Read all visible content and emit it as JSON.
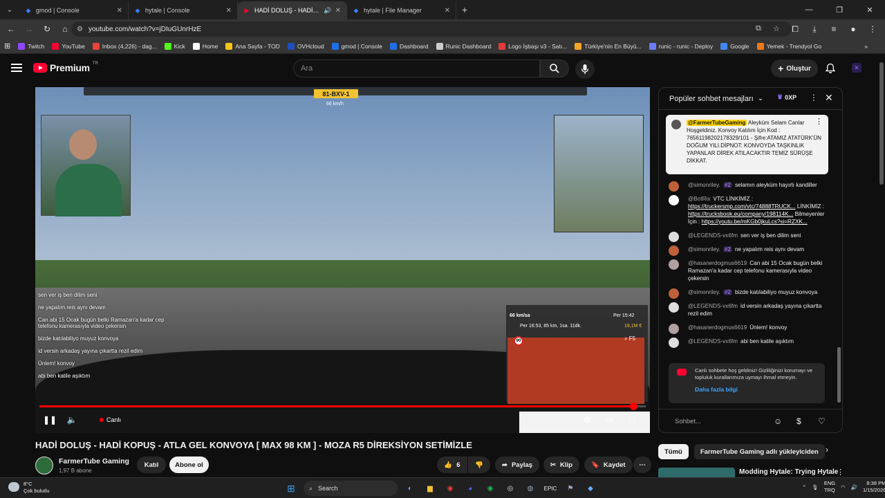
{
  "browser": {
    "tabs": [
      {
        "label": "gmod | Console",
        "active": false
      },
      {
        "label": "hytale | Console",
        "active": false
      },
      {
        "label": "HADİ DOLUŞ - HADİ KOPUŞ",
        "active": true
      },
      {
        "label": "hytale | File Manager",
        "active": false
      }
    ],
    "url": "youtube.com/watch?v=jDIuGUnrHzE",
    "bookmarks": [
      {
        "label": "Twitch",
        "color": "#9146ff"
      },
      {
        "label": "YouTube",
        "color": "#ff0033"
      },
      {
        "label": "Inbox (4,226) - dag...",
        "color": "#ea4335"
      },
      {
        "label": "Kick",
        "color": "#53fc18"
      },
      {
        "label": "Home",
        "color": "#ffffff"
      },
      {
        "label": "Ana Sayfa - TOD",
        "color": "#f5c518"
      },
      {
        "label": "OVHcloud",
        "color": "#1f4fbf"
      },
      {
        "label": "gmod | Console",
        "color": "#1f6feb"
      },
      {
        "label": "Dashboard",
        "color": "#1f6feb"
      },
      {
        "label": "Runic Dashboard",
        "color": "#cccccc"
      },
      {
        "label": "Logo İşbaşı v3 - Satı...",
        "color": "#e23b3b"
      },
      {
        "label": "Türkiye'nin En Büyü...",
        "color": "#f5a623"
      },
      {
        "label": "runic - runic - Deploy",
        "color": "#6b7cff"
      },
      {
        "label": "Google",
        "color": "#4285f4"
      },
      {
        "label": "Yemek - Trendyol Go",
        "color": "#f27a1a"
      }
    ]
  },
  "youtube": {
    "logo_text": "Premium",
    "logo_region": "TR",
    "search_placeholder": "Ara",
    "create_label": "Oluştur",
    "accent": "#ff0033"
  },
  "player": {
    "live_label": "Canlı",
    "progress_fraction": 0.98,
    "plate": "81-BXV-1",
    "hud_speed": "66 km/h",
    "hud_speed2": "66 km/sa",
    "hud_time1": "Per 15:42",
    "hud_eta": "Per 16:53, 85 km, 1sa. 11dk.",
    "hud_money": "19,1M €",
    "hud_limit": "90",
    "hud_f5": "F5",
    "overlay_chat": [
      "sen ver iş ben dilim seni",
      "ne yapalım reis aynı devam",
      "Can abi 15 Ocak bugün belki Ramazan'a kadar cep telefonu kamerasıyla video çekersin",
      "bizde katılabiliyo muyuz konvoya",
      "id versin arkadaş yayına çıkartta rezil edim",
      "Ünlem! konvoy",
      "abi ben katile aşıktım"
    ]
  },
  "video": {
    "title": "HADİ DOLUŞ - HADİ KOPUŞ - ATLA GEL KONVOYA [ MAX 98 KM ] - MOZA R5 DİREKSİYON SETİMİZLE",
    "channel": "FarmerTube Gaming",
    "subscribers": "1,97 B abone",
    "join_label": "Katıl",
    "subscribe_label": "Abone ol",
    "likes": "6",
    "share_label": "Paylaş",
    "clip_label": "Klip",
    "save_label": "Kaydet"
  },
  "chat": {
    "header": "Popüler sohbet mesajları",
    "xp": "0XP",
    "pinned": {
      "author": "@FarmerTubeGaming",
      "text": "Aleyküm Selam Canlar Hoşgeldiniz. Konvoy Katılım İçin Kod : 76561198202178329/101 - Şifre:ATAMIZ ATATÜRK'ÜN DOĞUM YILI.DİPNOT: KONVOYDA TAŞKINLIK YAPANLAR DİREK ATILACAKTIR TEMİZ SÜRÜŞE DİKKAT."
    },
    "messages": [
      {
        "author": "@simonriley.",
        "badge": "#2",
        "text": "selamın aleyküm hayırlı kandiller",
        "color": "#c0603a"
      },
      {
        "author": "@BotRix",
        "badge": "",
        "text": "VTC LİNKİMİZ : ",
        "link": "https://truckersmp.com/vtc/74888TRUCK...",
        "text2": " LİNKİMİZ : ",
        "link2": "https://trucksbook.eu/company/198114K...",
        "text3": " Bilmeyenler İçin : ",
        "link3": "https://youtu.be/mKGb0jkuLcs?si=RZXK...",
        "color": "#ffffff"
      },
      {
        "author": "@LEGENDS-vx6fm",
        "badge": "",
        "text": "sen ver iş ben dilim seni",
        "color": "#dddddd"
      },
      {
        "author": "@simonriley.",
        "badge": "#2",
        "text": "ne yapalım reis aynı devam",
        "color": "#c0603a"
      },
      {
        "author": "@hasanerdogmus6619",
        "badge": "",
        "text": "Can abi 15 Ocak bugün belki Ramazan'a kadar cep telefonu kamerasıyla video çekersin",
        "color": "#b0a0a0"
      },
      {
        "author": "@simonriley.",
        "badge": "#2",
        "text": "bizde katılabiliyo muyuz konvoya",
        "color": "#c0603a"
      },
      {
        "author": "@LEGENDS-vx6fm",
        "badge": "",
        "text": "id versin arkadaş yayına çıkartta rezil edim",
        "color": "#dddddd"
      },
      {
        "author": "@hasanerdogmus6619",
        "badge": "",
        "text": "Ünlem! konvoy",
        "color": "#b0a0a0"
      },
      {
        "author": "@LEGENDS-vx6fm",
        "badge": "",
        "text": "abi ben katile aşıktım",
        "color": "#dddddd"
      }
    ],
    "welcome_text": "Canlı sohbete hoş geldiniz! Gizliliğinizi korumayı ve topluluk kurallarımıza uymayı ihmal etmeyin.",
    "welcome_more": "Daha fazla bilgi",
    "input_placeholder": "Sohbet..."
  },
  "chips": [
    "Tümü",
    "FarmerTube Gaming adlı yükleyiciden"
  ],
  "reco": {
    "title": "Modding Hytale: Trying Hytale"
  },
  "taskbar": {
    "temp": "8°C",
    "weather": "Çok bulutlu",
    "search": "Search",
    "lang1": "ENG",
    "lang2": "TRQ",
    "time": "8:38 PM",
    "date": "1/15/2026"
  }
}
